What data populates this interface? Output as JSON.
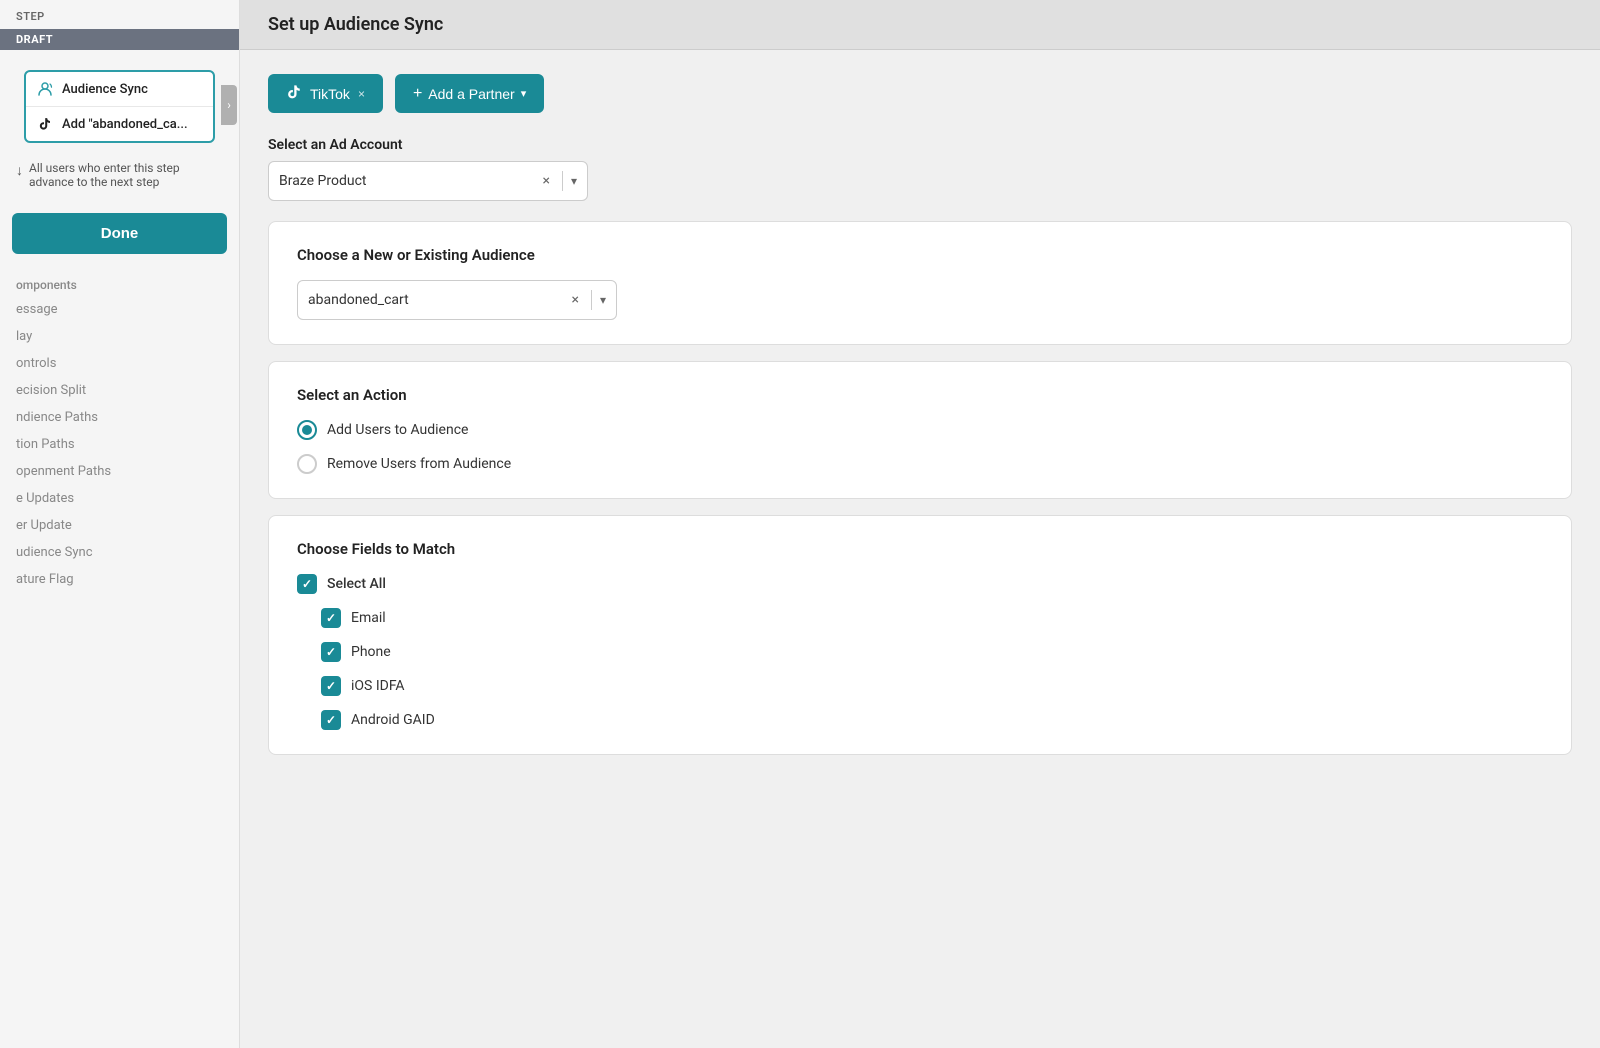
{
  "sidebar": {
    "step_label": "Step",
    "draft_badge": "DRAFT",
    "audience_sync_label": "Audience Sync",
    "add_tiktok_label": "Add \"abandoned_ca...",
    "info_text": "All users who enter this step advance to the next step",
    "done_button": "Done",
    "sections": [
      {
        "label": "omponents"
      },
      {
        "label": "essage"
      },
      {
        "label": "lay"
      },
      {
        "label": "ontrols"
      },
      {
        "label": "ecision Split"
      },
      {
        "label": "ndience Paths"
      },
      {
        "label": "tion Paths"
      },
      {
        "label": "openment Paths"
      },
      {
        "label": "e Updates"
      },
      {
        "label": "er Update"
      },
      {
        "label": "udience Sync"
      },
      {
        "label": "ature Flag"
      }
    ]
  },
  "main": {
    "header_title": "Set up Audience Sync",
    "tiktok_button_label": "TikTok",
    "add_partner_button_label": "Add a Partner",
    "ad_account": {
      "label": "Select an Ad Account",
      "value": "Braze Product"
    },
    "audience": {
      "label": "Choose a New or Existing Audience",
      "value": "abandoned_cart"
    },
    "action": {
      "label": "Select an Action",
      "options": [
        {
          "id": "add",
          "label": "Add Users to Audience",
          "selected": true
        },
        {
          "id": "remove",
          "label": "Remove Users from Audience",
          "selected": false
        }
      ]
    },
    "fields": {
      "label": "Choose Fields to Match",
      "select_all_label": "Select All",
      "items": [
        {
          "id": "email",
          "label": "Email",
          "checked": true
        },
        {
          "id": "phone",
          "label": "Phone",
          "checked": true
        },
        {
          "id": "ios_idfa",
          "label": "iOS IDFA",
          "checked": true
        },
        {
          "id": "android_gaid",
          "label": "Android GAID",
          "checked": true
        }
      ]
    }
  },
  "icons": {
    "audience_sync": "⟳",
    "tiktok": "♪",
    "chevron_right": "›",
    "chevron_down": "▾",
    "arrow_down": "↓",
    "close": "×",
    "plus": "+",
    "check": "✓"
  }
}
